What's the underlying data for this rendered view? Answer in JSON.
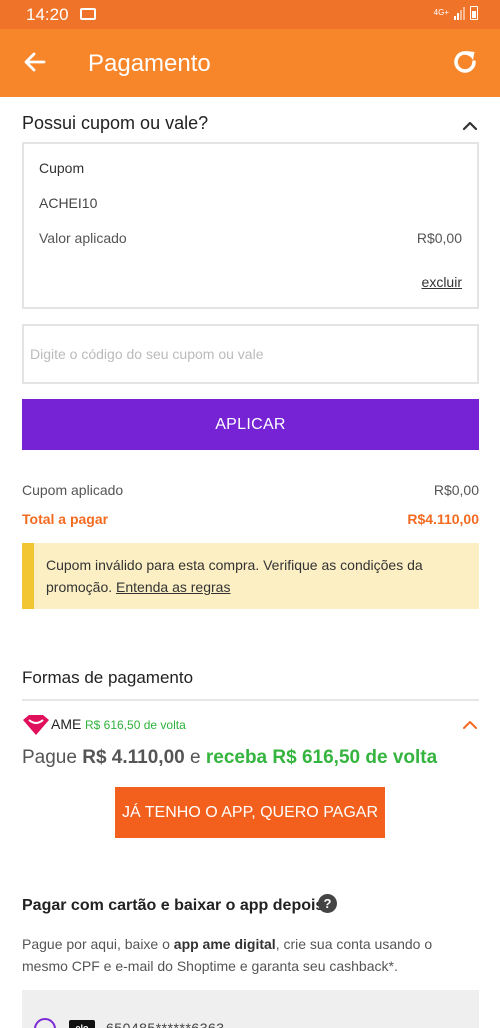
{
  "status_bar": {
    "time": "14:20",
    "network": "4G+"
  },
  "header": {
    "title": "Pagamento",
    "back_icon": "arrow-left-icon",
    "refresh_icon": "refresh-icon",
    "background": "#f7862b"
  },
  "coupon": {
    "heading": "Possui cupom ou vale?",
    "box": {
      "label": "Cupom",
      "code": "ACHEI10",
      "applied_label": "Valor aplicado",
      "applied_value": "R$0,00",
      "delete_label": "excluir"
    },
    "input_placeholder": "Digite o código do seu cupom ou vale",
    "apply_label": "APLICAR"
  },
  "summary": {
    "coupon_label": "Cupom aplicado",
    "coupon_value": "R$0,00",
    "total_label": "Total a pagar",
    "total_value": "R$4.110,00"
  },
  "warning": {
    "text": "Cupom inválido para esta compra. Verifique as condições da promoção.",
    "link": "Entenda as regras"
  },
  "payment": {
    "heading": "Formas de pagamento",
    "ame": {
      "name": "AME",
      "cashback": "R$ 616,50 de volta",
      "pay_prefix": "Pague",
      "pay_amount": "R$ 4.110,00",
      "pay_connector": "e",
      "pay_cashback": "receba R$ 616,50 de volta",
      "button_label": "JÁ TENHO O APP, QUERO PAGAR"
    },
    "card": {
      "heading": "Pagar com cartão e baixar o app depois",
      "desc_1": "Pague por aqui, baixe o",
      "desc_bold_1": "app ame digital",
      "desc_2": ", crie sua conta usando o mesmo CPF e e-mail do Shoptime e garanta seu cashback*.",
      "brand": "elo",
      "number": "650485******6363"
    }
  },
  "colors": {
    "accent_orange": "#f36b21",
    "purple": "#7623d6",
    "green": "#35b53f",
    "warning_bg": "#fcefc4",
    "warning_bar": "#f2c533"
  }
}
